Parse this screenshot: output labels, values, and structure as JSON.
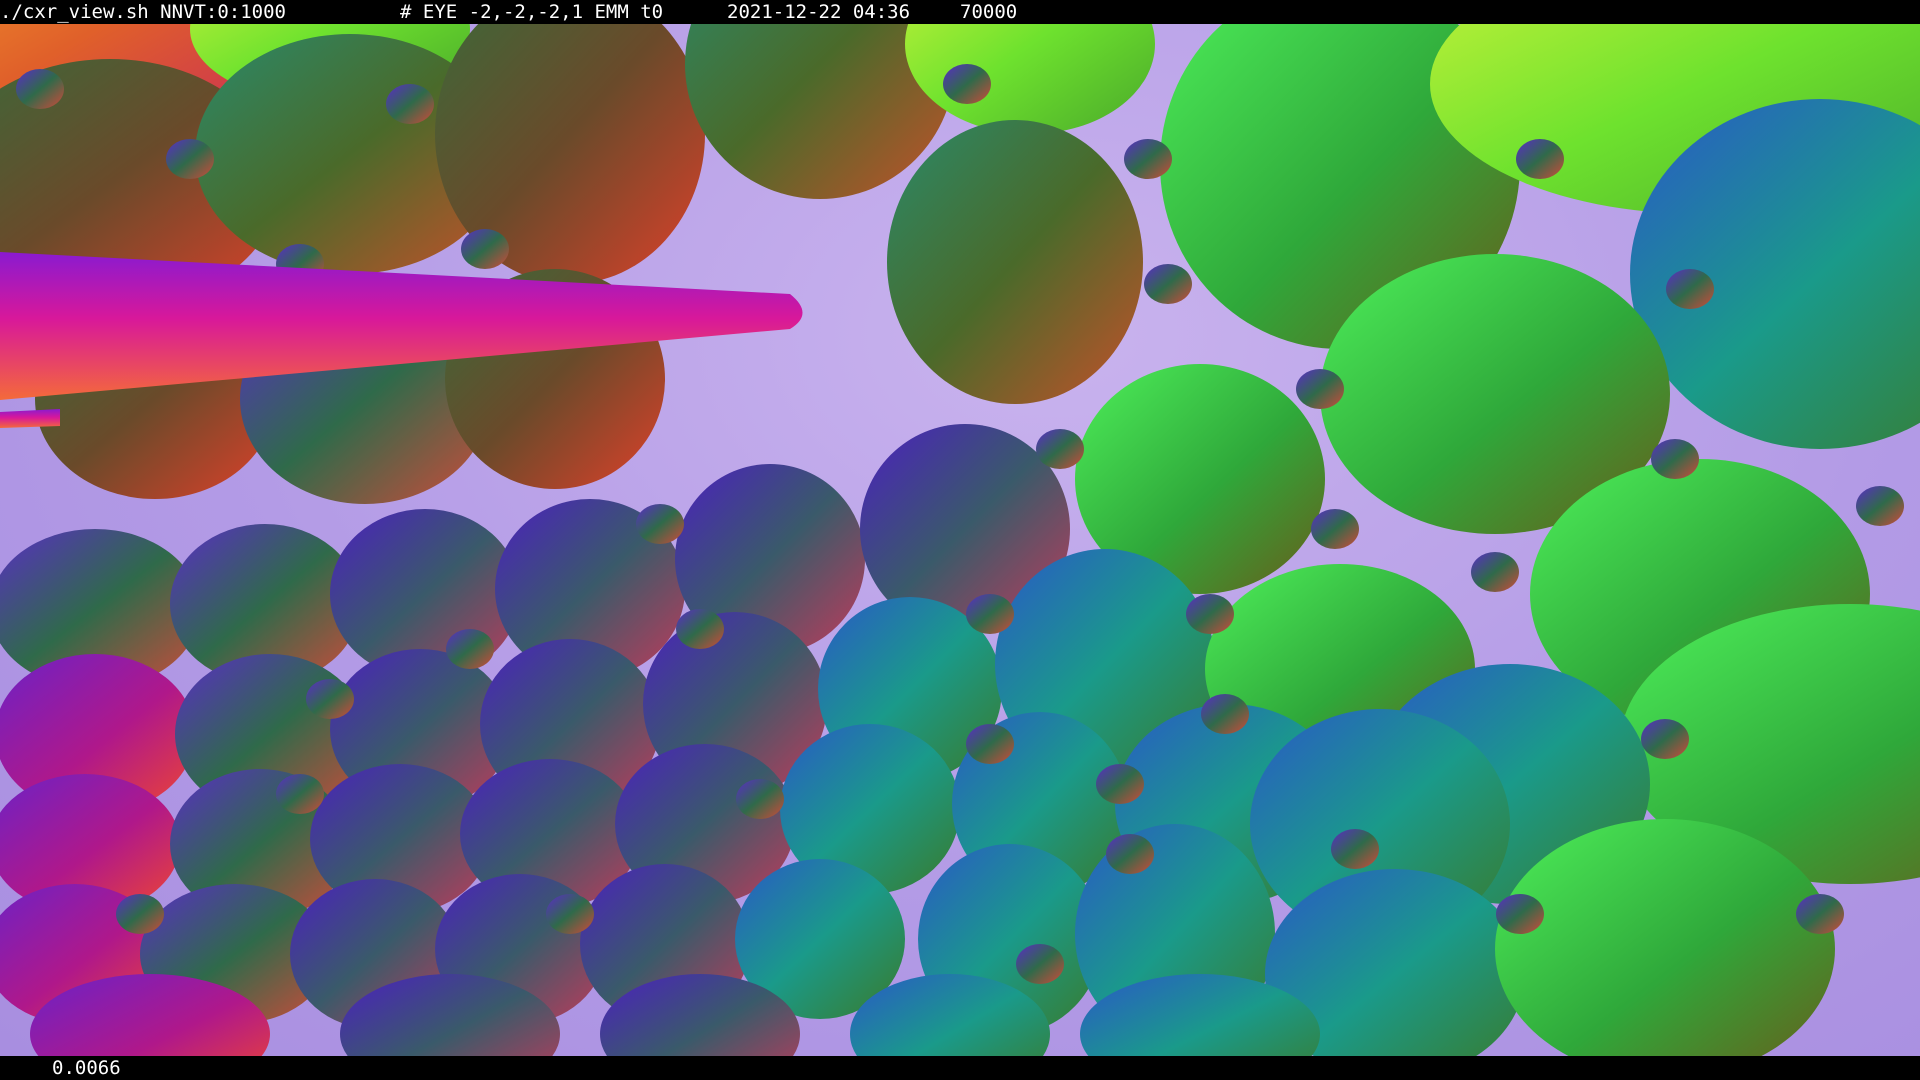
{
  "title_bar": {
    "command": "./cxr_view.sh NNVT:0:1000",
    "eye_info": "# EYE -2,-2,-2,1 EMM t0",
    "datetime": "2021-12-22 04:36",
    "count": "70000"
  },
  "viewport": {
    "background_color": "#b9a2ea",
    "palette": {
      "magenta": "#d81ea0",
      "purple": "#6a22c8",
      "green": "#3fd24a",
      "teal": "#1aa79a",
      "orange": "#f0781e",
      "olive": "#5a6a28",
      "dark_purple": "#4a2a8a"
    }
  },
  "status_bar": {
    "value": "0.0066"
  }
}
